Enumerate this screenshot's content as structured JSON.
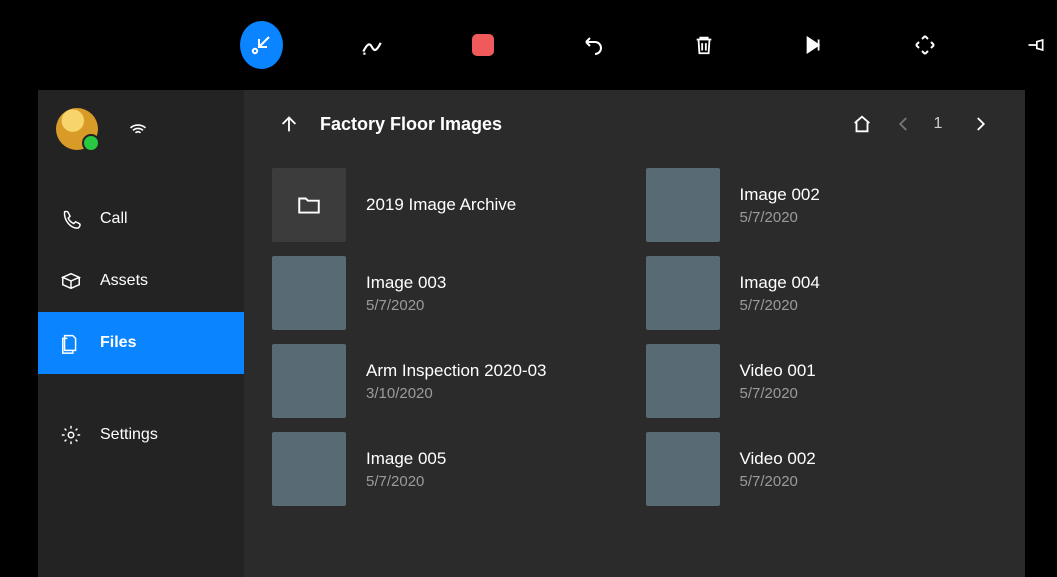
{
  "header": {
    "title": "Factory Floor Images",
    "page": "1"
  },
  "sidebar": {
    "items": [
      {
        "label": "Call"
      },
      {
        "label": "Assets"
      },
      {
        "label": "Files"
      },
      {
        "label": "Settings"
      }
    ]
  },
  "files": [
    {
      "name": "2019 Image Archive",
      "date": "",
      "kind": "folder"
    },
    {
      "name": "Image 002",
      "date": "5/7/2020",
      "kind": "image"
    },
    {
      "name": "Image 003",
      "date": "5/7/2020",
      "kind": "image"
    },
    {
      "name": "Image 004",
      "date": "5/7/2020",
      "kind": "image"
    },
    {
      "name": "Arm Inspection 2020-03",
      "date": "3/10/2020",
      "kind": "image"
    },
    {
      "name": "Video 001",
      "date": "5/7/2020",
      "kind": "video"
    },
    {
      "name": "Image 005",
      "date": "5/7/2020",
      "kind": "image"
    },
    {
      "name": "Video 002",
      "date": "5/7/2020",
      "kind": "video"
    }
  ]
}
